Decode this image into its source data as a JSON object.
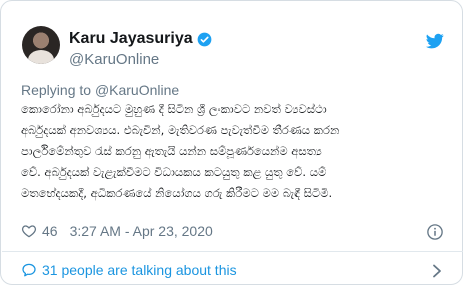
{
  "author": {
    "display_name": "Karu Jayasuriya",
    "handle": "@KaruOnline"
  },
  "reply": {
    "prefix": "Replying to ",
    "mention": "@KaruOnline"
  },
  "tweet": {
    "lines": [
      "කොරෝනා අර්බුදයට මුහුණ දී සිටින ශ්‍රී ලංකාවට නවත් ව්‍යවස්ථා",
      "අර්බුදයක් අනවශ්‍යය. එබැවින්, මැතිවරණ පැවැත්වීම තීරණය කරන",
      "පාර්ලිමේන්තුව රැස් කරනු ඇතැයි යන්න සම්පූර්ණයෙන්ම අසත්‍ය",
      "වේ. අර්බුදයක් වැළැක්වීමට විධායකය කටයුතු කළ යුතු වේ. යම්",
      "මතභේදයකදී, අධිකරණයේ නියෝගය ගරු කිරීමට මම බැඳී සිටිමි."
    ]
  },
  "meta": {
    "likes": "46",
    "timestamp": "3:27 AM - Apr 23, 2020"
  },
  "conversation": {
    "label": "31 people are talking about this"
  },
  "icons": {
    "verified": "verified-badge-icon",
    "bird": "twitter-bird-icon",
    "heart": "heart-icon",
    "info": "info-icon",
    "bubble": "speech-bubble-icon",
    "chevron": "chevron-right-icon"
  },
  "colors": {
    "accent": "#1da1f2",
    "link": "#1b95e0",
    "muted": "#657786",
    "text": "#14171a"
  }
}
